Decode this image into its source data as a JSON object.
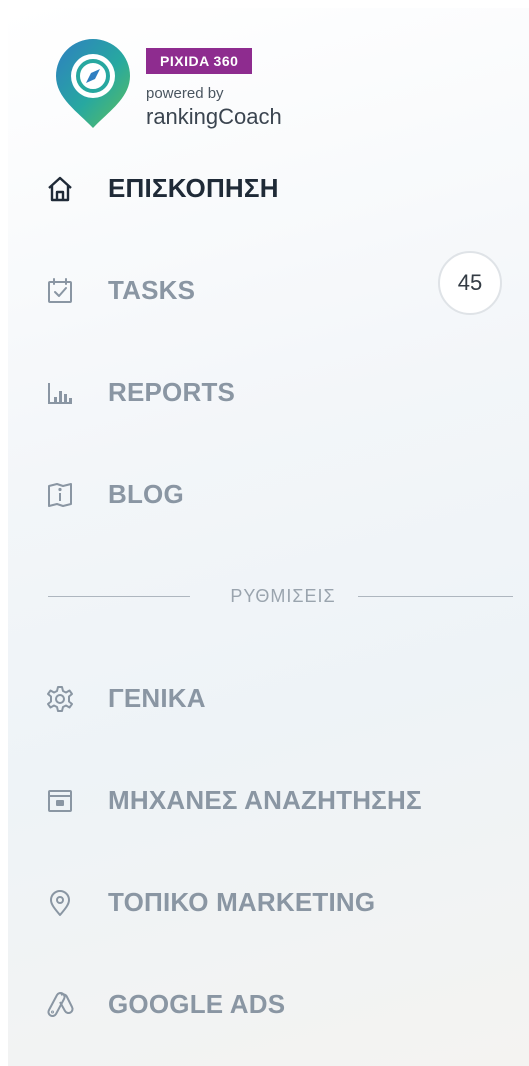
{
  "logo": {
    "badge": "PIXIDA 360",
    "powered": "powered by",
    "brand": "rankingCoach",
    "colors": {
      "badge": "#8e2c8f",
      "teal": "#27a8a0",
      "blue": "#2f7fc1",
      "green": "#5fbf5a"
    }
  },
  "nav": {
    "overview": {
      "label": "ΕΠΙΣΚΟΠΗΣΗ",
      "icon": "home-icon"
    },
    "tasks": {
      "label": "TASKS",
      "icon": "calendar-check-icon",
      "count": "45"
    },
    "reports": {
      "label": "REPORTS",
      "icon": "bar-chart-icon"
    },
    "blog": {
      "label": "BLOG",
      "icon": "book-icon"
    }
  },
  "section": {
    "label": "ΡΥΘΜΙΣΕΙΣ"
  },
  "settings": {
    "general": {
      "label": "ΓΕΝΙΚΑ",
      "icon": "gear-icon"
    },
    "search_engines": {
      "label": "ΜΗΧΑΝΕΣ ΑΝΑΖΗΤΗΣΗΣ",
      "icon": "browser-window-icon"
    },
    "local_marketing": {
      "label": "ΤΟΠΙΚΟ MARKETING",
      "icon": "location-pin-icon"
    },
    "google_ads": {
      "label": "GOOGLE ADS",
      "icon": "google-ads-icon"
    }
  },
  "theme": {
    "active_text": "#1f2a37",
    "inactive_text": "#8a96a3"
  }
}
